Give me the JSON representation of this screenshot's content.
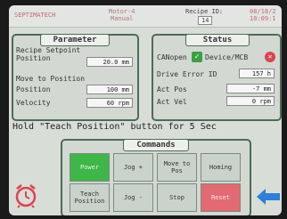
{
  "header": {
    "company": "SEPTIMATECH",
    "motor_line1": "Motor-4",
    "motor_line2": "Manual",
    "recipe_label": "Recipe ID:",
    "recipe_id": "14",
    "date": "08/18/2",
    "time": "10:09:1"
  },
  "parameter": {
    "title": "Parameter",
    "recipe_setpoint_line1": "Recipe Setpoint",
    "recipe_setpoint_line2": "Position",
    "recipe_setpoint_value": "20.0 mm",
    "move_to_position": "Move to Position",
    "position_label": "Position",
    "position_value": "100 mm",
    "velocity_label": "Velocity",
    "velocity_value": "60 rpm"
  },
  "status": {
    "title": "Status",
    "canopen": "CANopen",
    "device_mcb": "Device/MCB",
    "drive_error_label": "Drive Error ID",
    "drive_error_value": "157 h",
    "act_pos_label": "Act Pos",
    "act_pos_value": "-7 mm",
    "act_vel_label": "Act Vel",
    "act_vel_value": "0 rpm"
  },
  "message": "Hold \"Teach Position\" button for 5 Sec",
  "commands": {
    "title": "Commands",
    "power": "Power",
    "jog_plus": "Jog +",
    "move_to_pos_line1": "Move to",
    "move_to_pos_line2": "Pos",
    "homing": "Homing",
    "teach_line1": "Teach",
    "teach_line2": "Position",
    "jog_minus": "Jog -",
    "stop": "Stop",
    "reset": "Reset"
  },
  "colors": {
    "accent": "#3fb648",
    "alarm": "#d9444f",
    "panel_border": "#4d6b58",
    "back_arrow": "#2f7fd6"
  },
  "icons": {
    "alarm": "alarm-clock-icon",
    "back": "back-arrow-icon",
    "canopen_status": "check-icon",
    "device_status": "error-x-icon"
  }
}
